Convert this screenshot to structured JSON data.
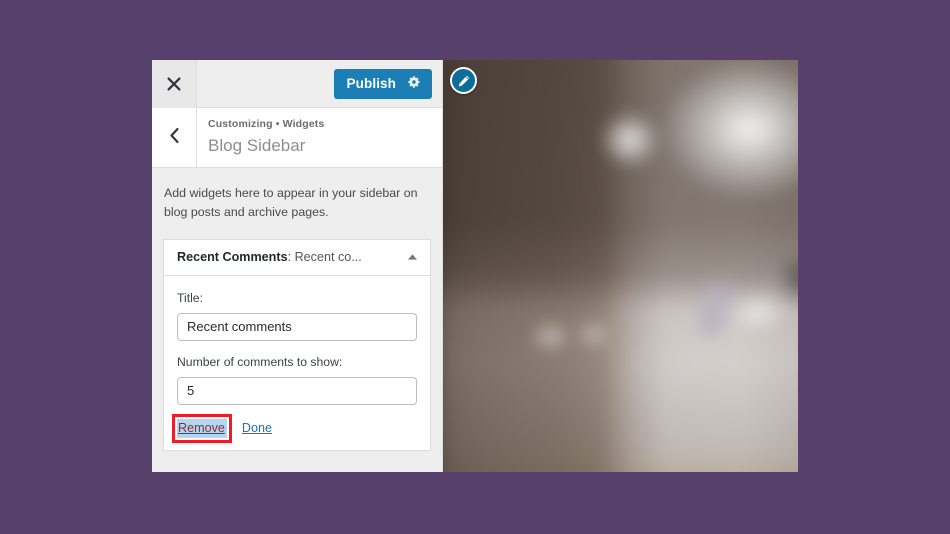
{
  "page": {
    "background_color": "#57406b"
  },
  "customizer": {
    "topbar": {
      "close_icon": "close-x-icon",
      "publish_label": "Publish",
      "publish_color": "#1b7eb5",
      "gear_icon": "gear-icon"
    },
    "header": {
      "back_icon": "chevron-left-icon",
      "breadcrumb": "Customizing • Widgets",
      "title": "Blog Sidebar"
    },
    "body": {
      "description": "Add widgets here to appear in your sidebar on blog posts and archive pages."
    },
    "widget": {
      "name": "Recent Comments",
      "instance_label": ": Recent co...",
      "toggle_icon": "chevron-up-icon",
      "expanded": true,
      "fields": [
        {
          "label": "Title:",
          "value": "Recent comments",
          "placeholder": "",
          "type": "text"
        },
        {
          "label": "Number of comments to show:",
          "value": "5",
          "placeholder": "",
          "type": "number"
        }
      ],
      "actions": {
        "remove_label": "Remove",
        "remove_text_color": "#8f2f35",
        "remove_selection_color": "#b5d4f0",
        "done_label": "Done",
        "done_color": "#2271b1"
      }
    },
    "preview": {
      "edit_icon": "pencil-edit-icon",
      "edit_button_color": "#0b6d99",
      "alt_description": "Blurred photo of a room interior with a bright window on the right and a light countertop"
    }
  },
  "annotation": {
    "highlight_target": "Remove",
    "box_color": "#ee1c25"
  }
}
